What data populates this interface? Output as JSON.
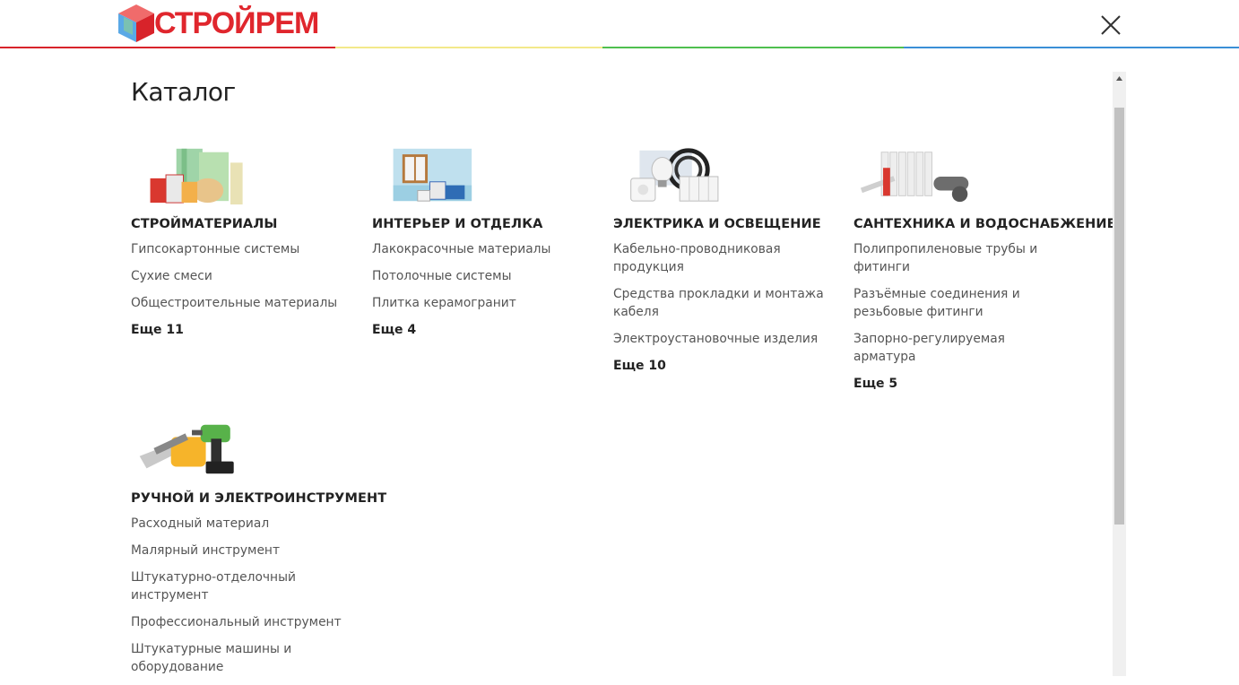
{
  "header": {
    "logo_text": "СТРОЙРЕМ",
    "close_icon": "close-icon",
    "accent_colors": [
      "#d8232a",
      "#f3e98a",
      "#4fbf4f",
      "#3a8fd6"
    ]
  },
  "catalog": {
    "title": "Каталог",
    "categories": [
      {
        "title": "СТРОЙМАТЕРИАЛЫ",
        "image": "building-materials-image",
        "links": [
          "Гипсокартонные системы",
          "Сухие смеси",
          "Общестроительные материалы"
        ],
        "more": "Еще 11"
      },
      {
        "title": "ИНТЕРЬЕР И ОТДЕЛКА",
        "image": "interior-finishing-image",
        "links": [
          "Лакокрасочные материалы",
          "Потолочные системы",
          "Плитка керамогранит"
        ],
        "more": "Еще 4"
      },
      {
        "title": "ЭЛЕКТРИКА И ОСВЕЩЕНИЕ",
        "image": "electrical-lighting-image",
        "links": [
          "Кабельно-проводниковая продукция",
          "Средства прокладки и монтажа кабеля",
          "Электроустановочные изделия"
        ],
        "more": "Еще 10"
      },
      {
        "title": "САНТЕХНИКА И ВОДОСНАБЖЕНИЕ",
        "image": "plumbing-image",
        "links": [
          "Полипропиленовые трубы и фитинги",
          "Разъёмные соединения и резьбовые фитинги",
          "Запорно-регулируемая арматура"
        ],
        "more": "Еще 5"
      },
      {
        "title": "РУЧНОЙ И ЭЛЕКТРОИНСТРУМЕНТ",
        "image": "tools-image",
        "links": [
          "Расходный материал",
          "Малярный инструмент",
          "Штукатурно-отделочный инструмент",
          "Профессиональный инструмент",
          "Штукатурные машины и оборудование"
        ],
        "more": ""
      }
    ]
  }
}
